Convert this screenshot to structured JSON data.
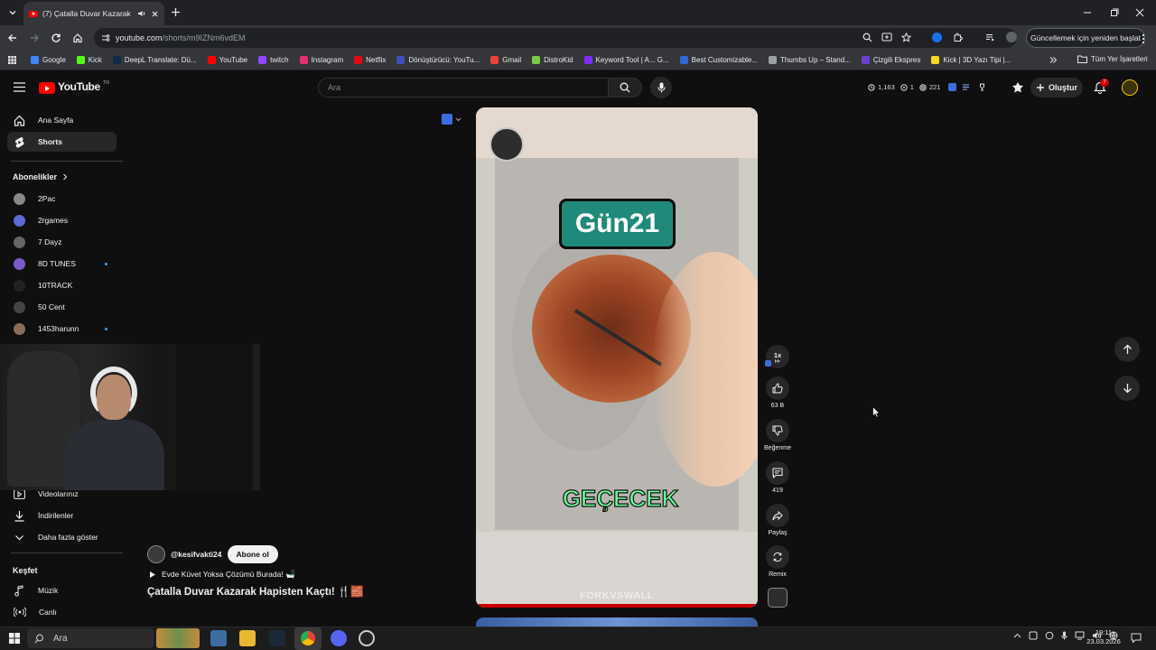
{
  "browser": {
    "tab_title": "(7) Çatalla Duvar Kazarak Hapisten Kaçtı!",
    "url_host": "youtube.com",
    "url_path": "/shorts/m9IZNm6vdEM",
    "update_button": "Güncellemek için yeniden başlat",
    "bookmarks": [
      {
        "label": "Google",
        "color": "#4285f4"
      },
      {
        "label": "Kick",
        "color": "#53fc18"
      },
      {
        "label": "DeepL Translate: Dü...",
        "color": "#0f2b46"
      },
      {
        "label": "YouTube",
        "color": "#ff0000"
      },
      {
        "label": "twitch",
        "color": "#9146ff"
      },
      {
        "label": "Instagram",
        "color": "#e1306c"
      },
      {
        "label": "Netflix",
        "color": "#e50914"
      },
      {
        "label": "Dönüştürücü: YouTu...",
        "color": "#3f51b5"
      },
      {
        "label": "Gmail",
        "color": "#ea4335"
      },
      {
        "label": "DistroKid",
        "color": "#7ac943"
      },
      {
        "label": "Keyword Tool | A... G...",
        "color": "#7b2ff7"
      },
      {
        "label": "Best Customizable...",
        "color": "#3367d6"
      },
      {
        "label": "Thumbs Up – Stand...",
        "color": "#9aa0a6"
      },
      {
        "label": "Çizgili Ekspres",
        "color": "#6c3fd1"
      },
      {
        "label": "Kick | 3D Yazı Tipi |...",
        "color": "#f9d71c"
      }
    ],
    "all_bookmarks": "Tüm Yer İşaretleri"
  },
  "youtube": {
    "logo_text": "YouTube",
    "logo_region": "TR",
    "search_placeholder": "Ara",
    "stats": {
      "a": "1,163",
      "b": "1",
      "c": "221"
    },
    "create_label": "Oluştur",
    "notification_count": "7"
  },
  "sidebar": {
    "items": [
      {
        "label": "Ana Sayfa"
      },
      {
        "label": "Shorts"
      }
    ],
    "subscriptions_header": "Abonelikler",
    "subscriptions": [
      {
        "label": "2Pac",
        "color": "#888",
        "live": false
      },
      {
        "label": "2rgames",
        "color": "#5b6bd6",
        "live": false
      },
      {
        "label": "7 Dayz",
        "color": "#666",
        "live": false
      },
      {
        "label": "8D TUNES",
        "color": "#7a5cc8",
        "live": true
      },
      {
        "label": "10TRACK",
        "color": "#222",
        "live": false
      },
      {
        "label": "50 Cent",
        "color": "#444",
        "live": false
      },
      {
        "label": "1453harunn",
        "color": "#8a6e5a",
        "live": true
      }
    ],
    "you_items": [
      {
        "label": "Videolarınız"
      },
      {
        "label": "İndirilenler"
      },
      {
        "label": "Daha fazla göster"
      }
    ],
    "explore_header": "Keşfet",
    "explore_items": [
      {
        "label": "Müzik"
      },
      {
        "label": "Canlı"
      }
    ]
  },
  "short": {
    "caption_top": "Gün21",
    "caption_bottom": "GEÇECEK",
    "watermark": "FORKVSWALL",
    "channel": "@kesifvakti24",
    "subscribe_label": "Abone ol",
    "playlist_line": "Evde Küvet Yoksa Çözümü Burada! 🛁",
    "title": "Çatalla Duvar Kazarak Hapisten Kaçtı! 🍴🧱",
    "speed": "1x",
    "likes": "63 B",
    "dislike_label": "Beğenme",
    "comments": "419",
    "share_label": "Paylaş",
    "remix_label": "Remix"
  },
  "taskbar": {
    "search_label": "Ara",
    "time": "19:11",
    "date": "23.03.2026"
  }
}
